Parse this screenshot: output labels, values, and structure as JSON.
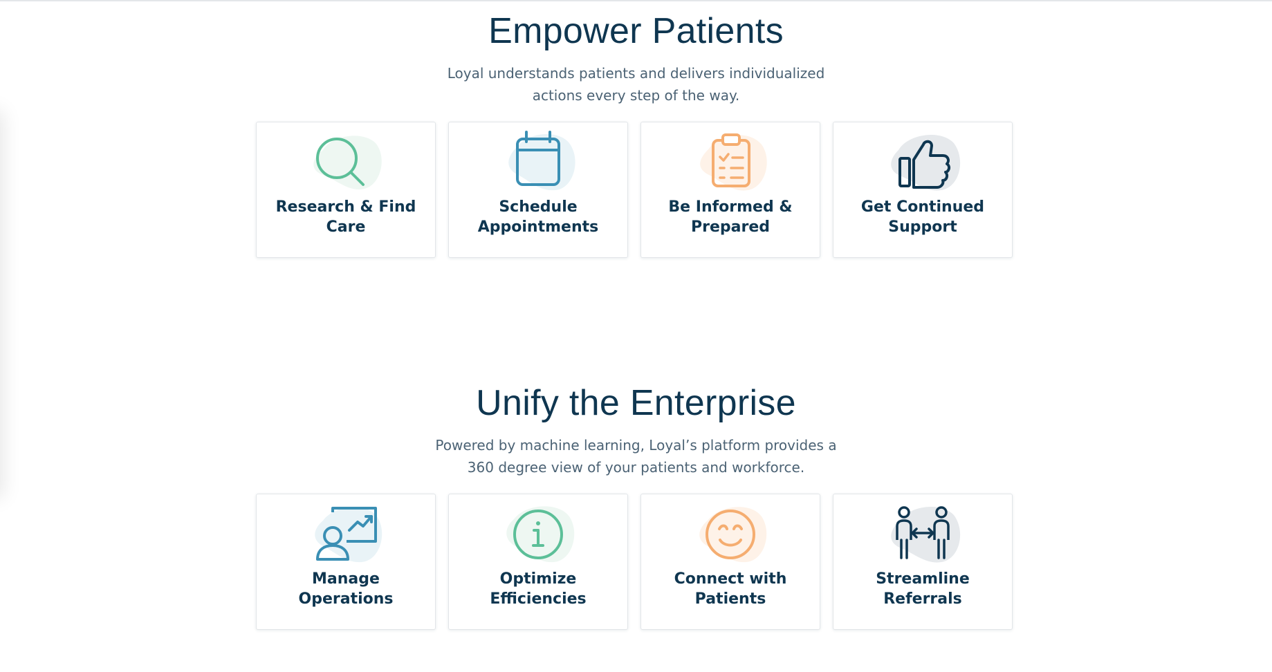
{
  "sections": [
    {
      "title": "Empower Patients",
      "description": "Loyal understands patients and delivers individualized actions every step of the way.",
      "cards": [
        {
          "label": "Research & Find Care",
          "icon": "search-icon",
          "color": "#5cbf98",
          "blob": "#eef7f2"
        },
        {
          "label": "Schedule Appointments",
          "icon": "calendar-icon",
          "color": "#3a8fb4",
          "blob": "#e9f3f7"
        },
        {
          "label": "Be Informed & Prepared",
          "icon": "clipboard-icon",
          "color": "#f5ad70",
          "blob": "#fef2e8"
        },
        {
          "label": "Get Continued Support",
          "icon": "thumbs-up-icon",
          "color": "#0f3650",
          "blob": "#e6e9ec"
        }
      ]
    },
    {
      "title": "Unify the Enterprise",
      "description": "Powered by machine learning, Loyal’s platform provides a 360 degree view of your patients and workforce.",
      "cards": [
        {
          "label": "Manage Operations",
          "icon": "presentation-icon",
          "color": "#3a8fb4",
          "blob": "#e9f3f7"
        },
        {
          "label": "Optimize Efficiencies",
          "icon": "info-icon",
          "color": "#5cbf98",
          "blob": "#eef7f2"
        },
        {
          "label": "Connect with Patients",
          "icon": "smile-icon",
          "color": "#f5ad70",
          "blob": "#fef2e8"
        },
        {
          "label": "Streamline Referrals",
          "icon": "referral-icon",
          "color": "#0f3650",
          "blob": "#e6e9ec"
        }
      ]
    }
  ]
}
